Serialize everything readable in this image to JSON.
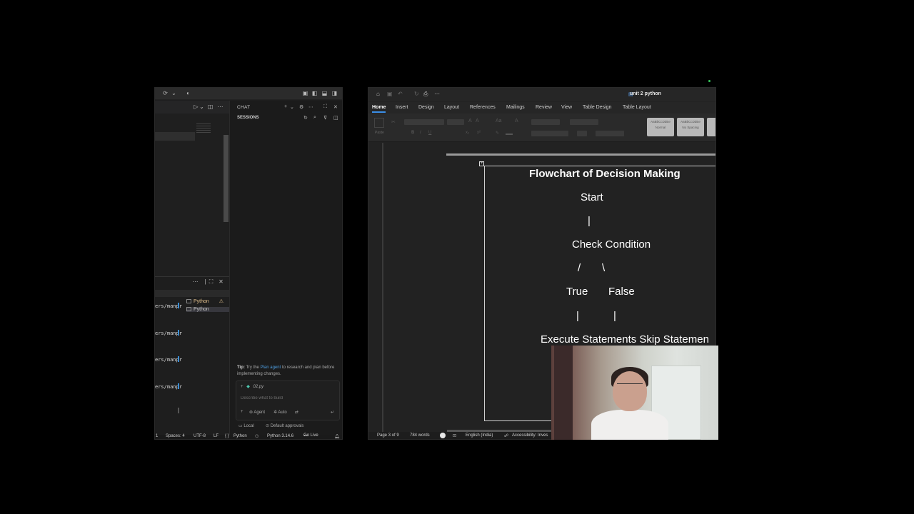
{
  "vscode": {
    "chat_tab": "CHAT",
    "sessions_label": "SESSIONS",
    "terminal_lines": [
      "ers/manpr",
      "ers/manpr",
      "ers/manpr",
      "ers/manpr"
    ],
    "terminals": [
      {
        "label": "Python",
        "warning": true
      },
      {
        "label": "Python",
        "warning": false
      }
    ],
    "tip": {
      "prefix": "Tip:",
      "text_before": " Try the ",
      "link": "Plan agent",
      "text_after": " to research and plan before implementing changes."
    },
    "context_file": "02.py",
    "chat_placeholder": "Describe what to build",
    "agent_label": "Agent",
    "auto_label": "Auto",
    "local_label": "Local",
    "approvals_label": "Default approvals",
    "status": {
      "line": "1",
      "spaces": "Spaces: 4",
      "encoding": "UTF-8",
      "eol": "LF",
      "language": "Python",
      "interpreter": "Python 3.14.6",
      "golive": "Go Live"
    }
  },
  "word": {
    "doc_title": "unit 2 python",
    "tabs": [
      "Home",
      "Insert",
      "Design",
      "Layout",
      "References",
      "Mailings",
      "Review",
      "View",
      "Table Design",
      "Table Layout"
    ],
    "active_tab": "Home",
    "paste_label": "Paste",
    "styles": [
      {
        "preview": "AaBbCcDdEe",
        "name": "Normal"
      },
      {
        "preview": "AaBbCcDdEe",
        "name": "No Spacing"
      }
    ],
    "flowchart": {
      "title": "Flowchart of Decision Making",
      "start": "Start",
      "pipe": "|",
      "check": "Check Condition",
      "slash": "/",
      "backslash": "\\",
      "true_label": "True",
      "false_label": "False",
      "exec": "Execute Statements Skip Statemen"
    },
    "status": {
      "page": "Page 3 of 9",
      "words": "784 words",
      "language": "English (India)",
      "accessibility": "Accessibility: Inves"
    }
  }
}
